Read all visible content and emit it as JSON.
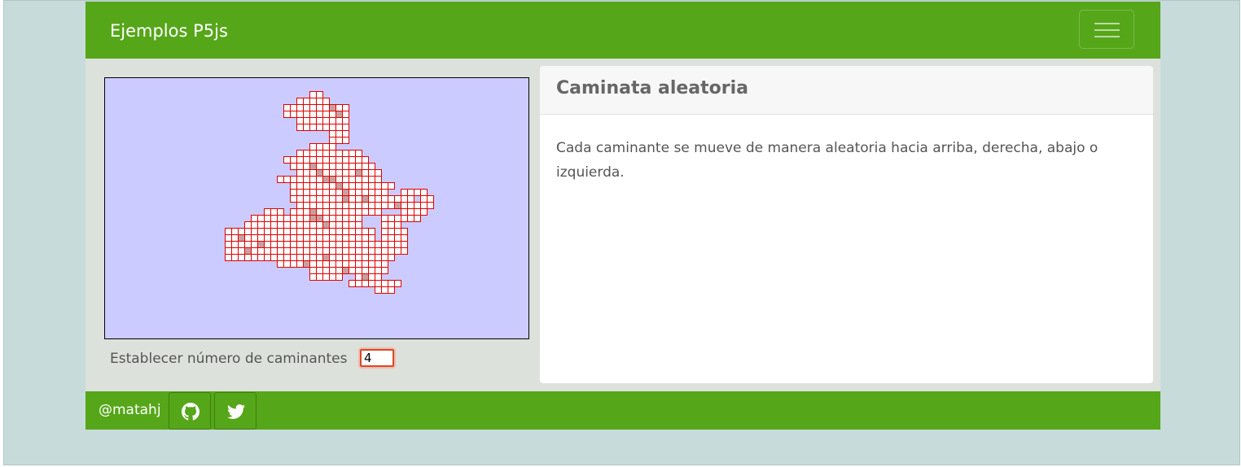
{
  "navbar": {
    "brand": "Ejemplos P5js",
    "menu_icon": "hamburger-menu-icon"
  },
  "sketch": {
    "background": "#cccbff",
    "cell_stroke": "#e00000",
    "cell_fill": "#ffffff",
    "visited_fill": "#c8a0a0"
  },
  "controls": {
    "walkers_label": "Establecer número de caminantes",
    "walkers_value": "4"
  },
  "card": {
    "title": "Caminata aleatoria",
    "body": "Cada caminante se mueve de manera aleatoria hacia arriba, derecha, abajo o izquierda."
  },
  "footer": {
    "handle": "@matahj",
    "github_icon": "github-icon",
    "twitter_icon": "twitter-icon"
  },
  "colors": {
    "brand_green": "#56a619",
    "page_background": "#c7dbda",
    "container_background": "#dde1dc"
  }
}
